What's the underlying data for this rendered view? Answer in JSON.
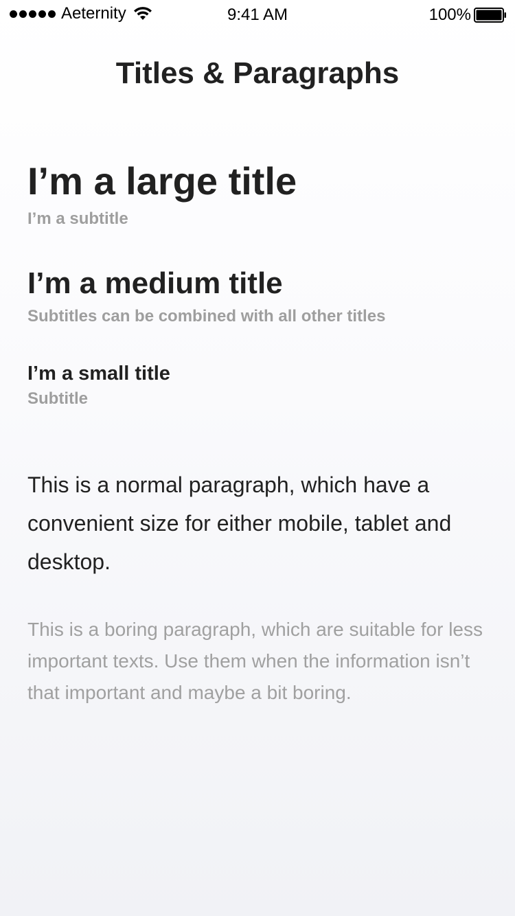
{
  "status_bar": {
    "carrier": "Aeternity",
    "time": "9:41 AM",
    "battery": "100%"
  },
  "nav": {
    "title": "Titles & Paragraphs"
  },
  "content": {
    "large_title": "I’m a large title",
    "large_subtitle": "I’m a subtitle",
    "medium_title": "I’m a medium title",
    "medium_subtitle": "Subtitles can be combined with all other titles",
    "small_title": "I’m a small title",
    "small_subtitle": "Subtitle",
    "paragraph": "This is a normal paragraph, which have a convenient size for either mobile, tablet and desktop.",
    "boring_paragraph": "This is a boring paragraph, which are suitable for less important texts. Use them when the information isn’t that important and maybe a bit boring."
  },
  "icons": {
    "signal": "signal-dots-icon",
    "wifi": "wifi-icon",
    "battery": "battery-icon"
  },
  "colors": {
    "primary_text": "#212121",
    "secondary_text": "#9e9e9e"
  }
}
